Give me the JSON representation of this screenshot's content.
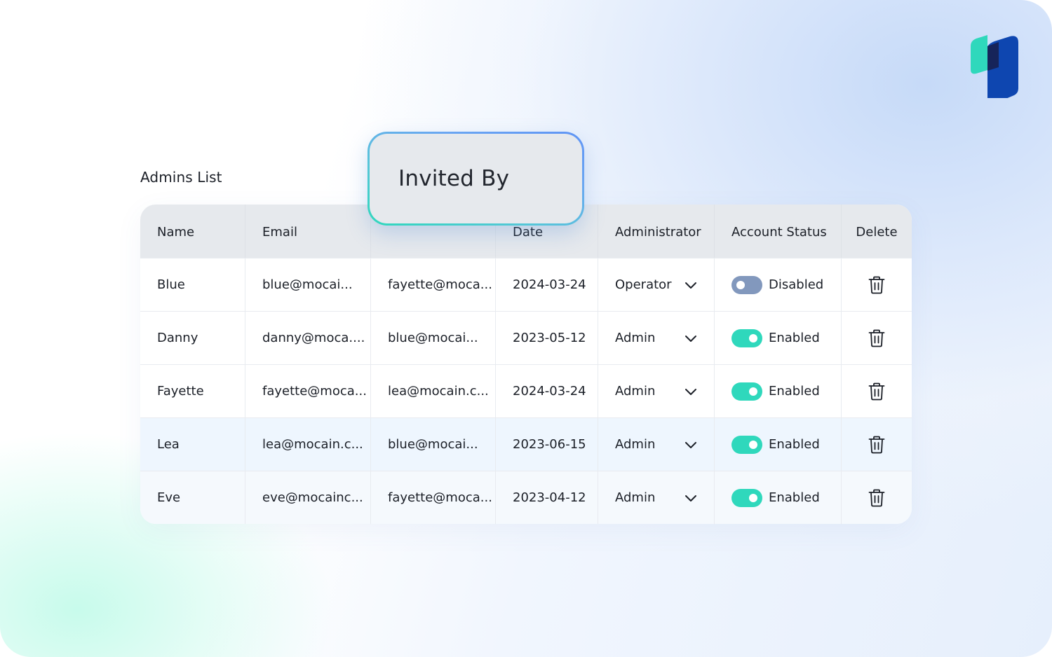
{
  "page": {
    "section_title": "Admins List"
  },
  "floating_label": {
    "text": "Invited By"
  },
  "table": {
    "headers": {
      "name": "Name",
      "email": "Email",
      "invited_by": "",
      "date": "Date",
      "administrator": "Administrator",
      "account_status": "Account Status",
      "delete": "Delete"
    },
    "rows": [
      {
        "name": "Blue",
        "email": "blue@mocai...",
        "invited_by": "fayette@moca...",
        "date": "2024-03-24",
        "role": "Operator",
        "status": "Disabled",
        "enabled": false
      },
      {
        "name": "Danny",
        "email": "danny@moca....",
        "invited_by": "blue@mocai...",
        "date": "2023-05-12",
        "role": "Admin",
        "status": "Enabled",
        "enabled": true
      },
      {
        "name": "Fayette",
        "email": "fayette@moca...",
        "invited_by": "lea@mocain.c...",
        "date": "2024-03-24",
        "role": "Admin",
        "status": "Enabled",
        "enabled": true
      },
      {
        "name": "Lea",
        "email": "lea@mocain.c...",
        "invited_by": "blue@mocai...",
        "date": "2023-06-15",
        "role": "Admin",
        "status": "Enabled",
        "enabled": true
      },
      {
        "name": "Eve",
        "email": "eve@mocainc...",
        "invited_by": "fayette@moca...",
        "date": "2023-04-12",
        "role": "Admin",
        "status": "Enabled",
        "enabled": true
      }
    ]
  },
  "icons": {
    "logo": "brand-logo-icon",
    "dropdown": "chevron-down-icon",
    "delete": "trash-icon",
    "toggle": "toggle-switch"
  },
  "colors": {
    "toggle_on": "#2fd8bc",
    "toggle_off": "#8298bd",
    "header_bg": "#e6e9ed",
    "logo_green": "#2fd8bc",
    "logo_blue": "#0e46b0",
    "logo_navy": "#16245a"
  }
}
